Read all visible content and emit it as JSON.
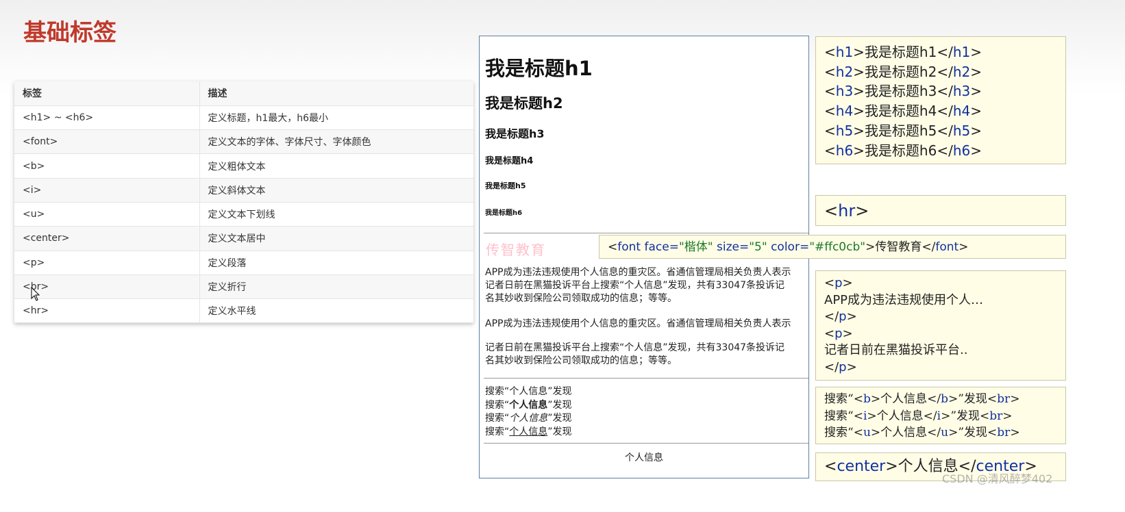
{
  "title": "基础标签",
  "table": {
    "headers": [
      "标签",
      "描述"
    ],
    "rows": [
      [
        "<h1> ~ <h6>",
        "定义标题，h1最大，h6最小"
      ],
      [
        "<font>",
        "定义文本的字体、字体尺寸、字体颜色"
      ],
      [
        "<b>",
        "定义粗体文本"
      ],
      [
        "<i>",
        "定义斜体文本"
      ],
      [
        "<u>",
        "定义文本下划线"
      ],
      [
        "<center>",
        "定义文本居中"
      ],
      [
        "<p>",
        "定义段落"
      ],
      [
        "<br>",
        "定义折行"
      ],
      [
        "<hr>",
        "定义水平线"
      ]
    ]
  },
  "preview": {
    "h1": "我是标题h1",
    "h2": "我是标题h2",
    "h3": "我是标题h3",
    "h4": "我是标题h4",
    "h5": "我是标题h5",
    "h6": "我是标题h6",
    "font_text": "传智教育",
    "font_color": "#ffc0cb",
    "para1_line1": "APP成为违法违规使用个人信息的重灾区。省通信管理局相关负责人表示",
    "para1_line2": "记者日前在黑猫投诉平台上搜索“个人信息”发现，共有33047条投诉记",
    "para1_line3": "名其妙收到保险公司领取成功的信息；等等。",
    "para2": "APP成为违法违规使用个人信息的重灾区。省通信管理局相关负责人表示",
    "para3_line1": "记者日前在黑猫投诉平台上搜索“个人信息”发现，共有33047条投诉记",
    "para3_line2": "名其妙收到保险公司领取成功的信息；等等。",
    "search_prefix": "搜索“",
    "search_word": "个人信息",
    "search_suffix": "”发现",
    "center_text": "个人信息"
  },
  "code": {
    "headings": [
      {
        "open": "h1",
        "text": "我是标题h1"
      },
      {
        "open": "h2",
        "text": "我是标题h2"
      },
      {
        "open": "h3",
        "text": "我是标题h3"
      },
      {
        "open": "h4",
        "text": "我是标题h4"
      },
      {
        "open": "h5",
        "text": "我是标题h5"
      },
      {
        "open": "h6",
        "text": "我是标题h6"
      }
    ],
    "hr": "hr",
    "font": {
      "tag": "font",
      "attr_face": "face=",
      "val_face": "\"楷体\"",
      "attr_size": "size=",
      "val_size": "\"5\"",
      "attr_color": "color=",
      "val_color": "\"#ffc0cb\"",
      "text": "传智教育"
    },
    "p_block": {
      "tag": "p",
      "text1": "APP成为违法违规使用个人…",
      "text2": "记者日前在黑猫投诉平台.."
    },
    "bi_block": {
      "prefix": "搜索“",
      "word": "个人信息",
      "suffix": "”发现",
      "tags": [
        "b",
        "i",
        "u"
      ],
      "br": "br"
    },
    "center": {
      "tag": "center",
      "text": "个人信息"
    }
  },
  "watermark": "CSDN @清风醉梦402"
}
